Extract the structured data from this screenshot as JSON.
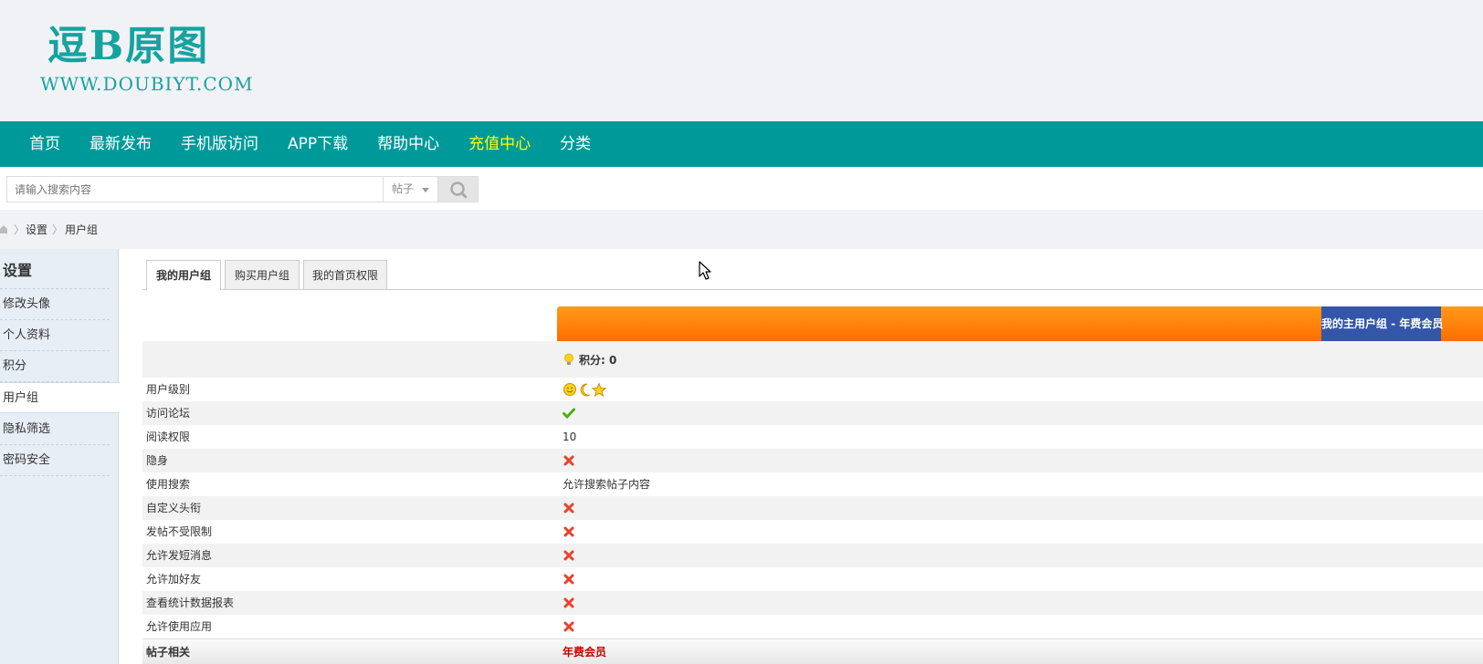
{
  "header": {
    "logo_text": "逗B原图",
    "logo_url": "WWW.DOUBIYT.COM",
    "brand_color": "#16a3a0"
  },
  "nav": {
    "bg_color": "#00999a",
    "items": [
      {
        "label": "首页"
      },
      {
        "label": "最新发布"
      },
      {
        "label": "手机版访问"
      },
      {
        "label": "APP下载"
      },
      {
        "label": "帮助中心"
      },
      {
        "label": "充值中心",
        "active": true
      },
      {
        "label": "分类"
      }
    ]
  },
  "search": {
    "placeholder": "请输入搜索内容",
    "type_selected": "帖子",
    "button_icon": "search-icon"
  },
  "breadcrumb": {
    "home_icon": "home-icon",
    "items": [
      "设置",
      "用户组"
    ]
  },
  "sidebar": {
    "title": "设置",
    "items": [
      {
        "label": "修改头像"
      },
      {
        "label": "个人资料"
      },
      {
        "label": "积分"
      },
      {
        "label": "用户组",
        "active": true
      },
      {
        "label": "隐私筛选"
      },
      {
        "label": "密码安全"
      }
    ]
  },
  "tabs": [
    {
      "label": "我的用户组",
      "active": true
    },
    {
      "label": "购买用户组"
    },
    {
      "label": "我的首页权限"
    }
  ],
  "group": {
    "label": "我的主用户组 - 年费会员",
    "points": "积分: 0"
  },
  "permissions": [
    {
      "label": "用户级别",
      "icon": "level-icons"
    },
    {
      "label": "访问论坛",
      "icon": "check-icon"
    },
    {
      "label": "阅读权限",
      "value": "10"
    },
    {
      "label": "隐身",
      "icon": "cross-icon"
    },
    {
      "label": "使用搜索",
      "value": "允许搜索帖子内容"
    },
    {
      "label": "自定义头衔",
      "icon": "cross-icon"
    },
    {
      "label": "发帖不受限制",
      "icon": "cross-icon"
    },
    {
      "label": "允许发短消息",
      "icon": "cross-icon"
    },
    {
      "label": "允许加好友",
      "icon": "cross-icon"
    },
    {
      "label": "查看统计数据报表",
      "icon": "cross-icon"
    },
    {
      "label": "允许使用应用",
      "icon": "cross-icon"
    }
  ],
  "footer_row": {
    "label": "帖子相关",
    "value": "年费会员"
  }
}
